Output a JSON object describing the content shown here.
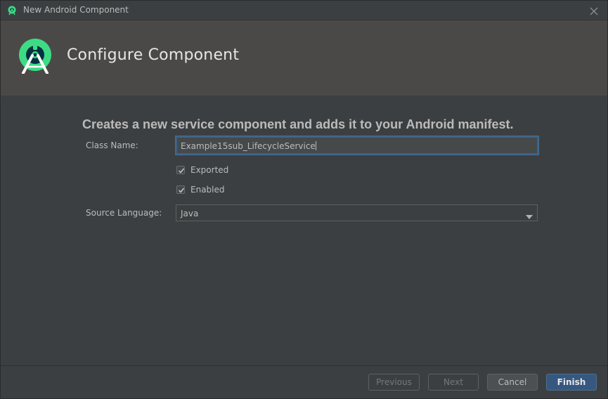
{
  "window": {
    "title": "New Android Component",
    "app_icon": "android-studio-icon",
    "close_icon": "close-icon"
  },
  "header": {
    "logo_icon": "android-studio-logo",
    "title": "Configure Component"
  },
  "main": {
    "description": "Creates a new service component and adds it to your Android manifest.",
    "class_name": {
      "label": "Class Name:",
      "value": "Example15sub_LifecycleService"
    },
    "exported": {
      "label": "Exported",
      "checked": true
    },
    "enabled": {
      "label": "Enabled",
      "checked": true
    },
    "source_language": {
      "label": "Source Language:",
      "value": "Java"
    }
  },
  "footer": {
    "previous_label": "Previous",
    "next_label": "Next",
    "cancel_label": "Cancel",
    "finish_label": "Finish"
  },
  "colors": {
    "accent": "#3ddc84",
    "primary_button": "#365880",
    "focus_border": "#3d6185"
  }
}
